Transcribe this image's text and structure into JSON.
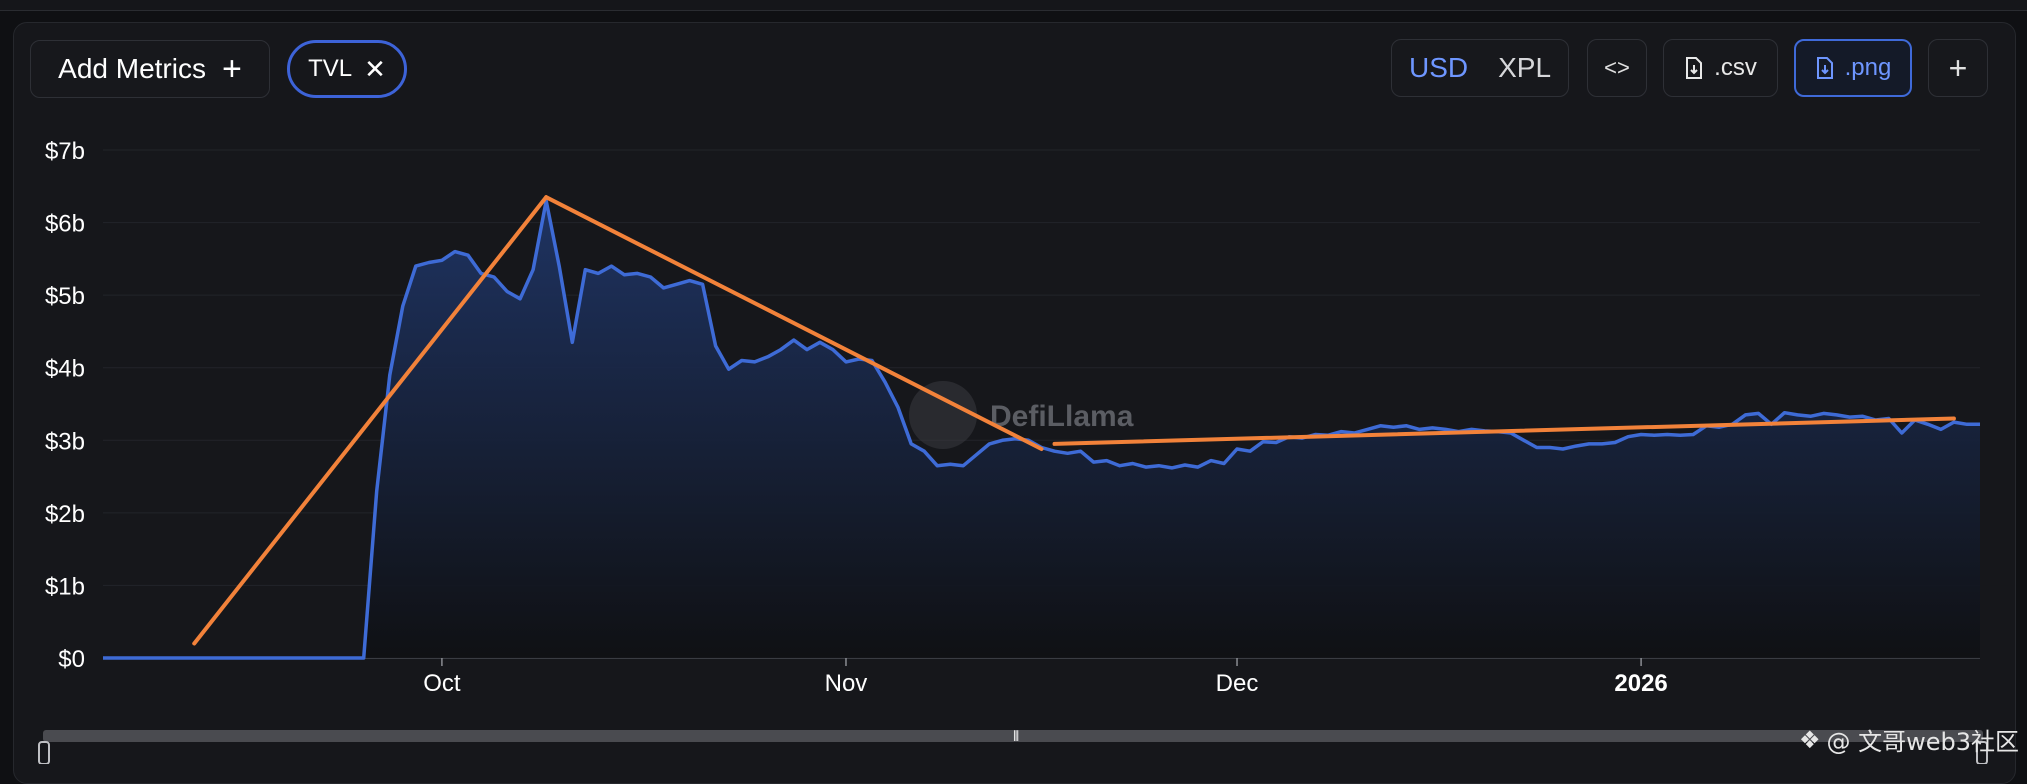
{
  "toolbar": {
    "add_metrics_label": "Add Metrics",
    "add_icon": "plus-icon",
    "metric_chip_label": "TVL",
    "chip_remove_icon": "close-icon",
    "currency_options": [
      "USD",
      "XPL"
    ],
    "currency_selected": "USD",
    "embed_icon": "code-icon",
    "csv_label": ".csv",
    "png_label": ".png",
    "download_icon": "file-download-icon",
    "more_icon": "plus-icon"
  },
  "colors": {
    "series": "#3e6bd6",
    "area_top": "#1f3566",
    "area_bottom": "#0f1013",
    "annotation": "#f2823a",
    "accent": "#6e96ff"
  },
  "chart_data": {
    "type": "area",
    "title": "",
    "xlabel": "",
    "ylabel": "",
    "ylim": [
      0,
      7
    ],
    "y_unit": "$b",
    "y_ticks": [
      "$0",
      "$1b",
      "$2b",
      "$3b",
      "$4b",
      "$5b",
      "$6b",
      "$7b"
    ],
    "x_ticks": [
      {
        "label": "Oct",
        "date": "2025-10-01",
        "bold": false
      },
      {
        "label": "Nov",
        "date": "2025-11-01",
        "bold": false
      },
      {
        "label": "Dec",
        "date": "2025-12-01",
        "bold": false
      },
      {
        "label": "2026",
        "date": "2026-01-01",
        "bold": true
      }
    ],
    "xlim": [
      "2025-09-05",
      "2026-01-27"
    ],
    "grid": true,
    "watermark": "DefiLlama",
    "series": [
      {
        "name": "TVL",
        "points": [
          [
            "2025-09-05",
            0
          ],
          [
            "2025-09-25",
            0
          ],
          [
            "2025-09-26",
            2.3
          ],
          [
            "2025-09-27",
            3.9
          ],
          [
            "2025-09-28",
            4.85
          ],
          [
            "2025-09-29",
            5.4
          ],
          [
            "2025-09-30",
            5.45
          ],
          [
            "2025-10-01",
            5.48
          ],
          [
            "2025-10-02",
            5.6
          ],
          [
            "2025-10-03",
            5.55
          ],
          [
            "2025-10-04",
            5.3
          ],
          [
            "2025-10-05",
            5.25
          ],
          [
            "2025-10-06",
            5.05
          ],
          [
            "2025-10-07",
            4.95
          ],
          [
            "2025-10-08",
            5.35
          ],
          [
            "2025-10-09",
            6.3
          ],
          [
            "2025-10-10",
            5.4
          ],
          [
            "2025-10-11",
            4.35
          ],
          [
            "2025-10-12",
            5.35
          ],
          [
            "2025-10-13",
            5.3
          ],
          [
            "2025-10-14",
            5.4
          ],
          [
            "2025-10-15",
            5.28
          ],
          [
            "2025-10-16",
            5.3
          ],
          [
            "2025-10-17",
            5.25
          ],
          [
            "2025-10-18",
            5.1
          ],
          [
            "2025-10-19",
            5.15
          ],
          [
            "2025-10-20",
            5.2
          ],
          [
            "2025-10-21",
            5.15
          ],
          [
            "2025-10-22",
            4.3
          ],
          [
            "2025-10-23",
            3.98
          ],
          [
            "2025-10-24",
            4.1
          ],
          [
            "2025-10-25",
            4.08
          ],
          [
            "2025-10-26",
            4.15
          ],
          [
            "2025-10-27",
            4.25
          ],
          [
            "2025-10-28",
            4.38
          ],
          [
            "2025-10-29",
            4.25
          ],
          [
            "2025-10-30",
            4.35
          ],
          [
            "2025-10-31",
            4.25
          ],
          [
            "2025-11-01",
            4.08
          ],
          [
            "2025-11-02",
            4.12
          ],
          [
            "2025-11-03",
            4.1
          ],
          [
            "2025-11-04",
            3.8
          ],
          [
            "2025-11-05",
            3.45
          ],
          [
            "2025-11-06",
            2.95
          ],
          [
            "2025-11-07",
            2.85
          ],
          [
            "2025-11-08",
            2.65
          ],
          [
            "2025-11-09",
            2.67
          ],
          [
            "2025-11-10",
            2.65
          ],
          [
            "2025-11-11",
            2.8
          ],
          [
            "2025-11-12",
            2.95
          ],
          [
            "2025-11-13",
            3.0
          ],
          [
            "2025-11-14",
            3.02
          ],
          [
            "2025-11-15",
            3.0
          ],
          [
            "2025-11-16",
            2.9
          ],
          [
            "2025-11-17",
            2.85
          ],
          [
            "2025-11-18",
            2.82
          ],
          [
            "2025-11-19",
            2.85
          ],
          [
            "2025-11-20",
            2.7
          ],
          [
            "2025-11-21",
            2.72
          ],
          [
            "2025-11-22",
            2.65
          ],
          [
            "2025-11-23",
            2.68
          ],
          [
            "2025-11-24",
            2.63
          ],
          [
            "2025-11-25",
            2.65
          ],
          [
            "2025-11-26",
            2.62
          ],
          [
            "2025-11-27",
            2.66
          ],
          [
            "2025-11-28",
            2.63
          ],
          [
            "2025-11-29",
            2.72
          ],
          [
            "2025-11-30",
            2.68
          ],
          [
            "2025-12-01",
            2.88
          ],
          [
            "2025-12-02",
            2.85
          ],
          [
            "2025-12-03",
            2.98
          ],
          [
            "2025-12-04",
            2.97
          ],
          [
            "2025-12-05",
            3.05
          ],
          [
            "2025-12-06",
            3.03
          ],
          [
            "2025-12-07",
            3.08
          ],
          [
            "2025-12-08",
            3.07
          ],
          [
            "2025-12-09",
            3.12
          ],
          [
            "2025-12-10",
            3.1
          ],
          [
            "2025-12-11",
            3.15
          ],
          [
            "2025-12-12",
            3.2
          ],
          [
            "2025-12-13",
            3.18
          ],
          [
            "2025-12-14",
            3.2
          ],
          [
            "2025-12-15",
            3.15
          ],
          [
            "2025-12-16",
            3.17
          ],
          [
            "2025-12-17",
            3.15
          ],
          [
            "2025-12-18",
            3.12
          ],
          [
            "2025-12-19",
            3.15
          ],
          [
            "2025-12-20",
            3.13
          ],
          [
            "2025-12-21",
            3.12
          ],
          [
            "2025-12-22",
            3.1
          ],
          [
            "2025-12-23",
            3.0
          ],
          [
            "2025-12-24",
            2.9
          ],
          [
            "2025-12-25",
            2.9
          ],
          [
            "2025-12-26",
            2.88
          ],
          [
            "2025-12-27",
            2.92
          ],
          [
            "2025-12-28",
            2.95
          ],
          [
            "2025-12-29",
            2.95
          ],
          [
            "2025-12-30",
            2.97
          ],
          [
            "2025-12-31",
            3.05
          ],
          [
            "2026-01-01",
            3.08
          ],
          [
            "2026-01-02",
            3.07
          ],
          [
            "2026-01-03",
            3.08
          ],
          [
            "2026-01-04",
            3.07
          ],
          [
            "2026-01-05",
            3.08
          ],
          [
            "2026-01-06",
            3.2
          ],
          [
            "2026-01-07",
            3.18
          ],
          [
            "2026-01-08",
            3.22
          ],
          [
            "2026-01-09",
            3.35
          ],
          [
            "2026-01-10",
            3.37
          ],
          [
            "2026-01-11",
            3.22
          ],
          [
            "2026-01-12",
            3.38
          ],
          [
            "2026-01-13",
            3.35
          ],
          [
            "2026-01-14",
            3.33
          ],
          [
            "2026-01-15",
            3.37
          ],
          [
            "2026-01-16",
            3.35
          ],
          [
            "2026-01-17",
            3.32
          ],
          [
            "2026-01-18",
            3.33
          ],
          [
            "2026-01-19",
            3.28
          ],
          [
            "2026-01-20",
            3.3
          ],
          [
            "2026-01-21",
            3.1
          ],
          [
            "2026-01-22",
            3.28
          ],
          [
            "2026-01-23",
            3.22
          ],
          [
            "2026-01-24",
            3.15
          ],
          [
            "2026-01-25",
            3.25
          ],
          [
            "2026-01-26",
            3.22
          ],
          [
            "2026-01-27",
            3.22
          ]
        ]
      }
    ],
    "annotations": [
      {
        "type": "trend-line",
        "from": [
          "2025-09-12",
          0.2
        ],
        "to": [
          "2025-10-09",
          6.35
        ]
      },
      {
        "type": "trend-line",
        "from": [
          "2025-10-09",
          6.35
        ],
        "to": [
          "2025-11-16",
          2.88
        ]
      },
      {
        "type": "trend-line",
        "from": [
          "2025-11-17",
          2.95
        ],
        "to": [
          "2026-01-25",
          3.3
        ]
      }
    ]
  },
  "footer": {
    "watermark_text": "@ 文哥web3社区",
    "watermark_icon": "binance-diamond-icon"
  }
}
